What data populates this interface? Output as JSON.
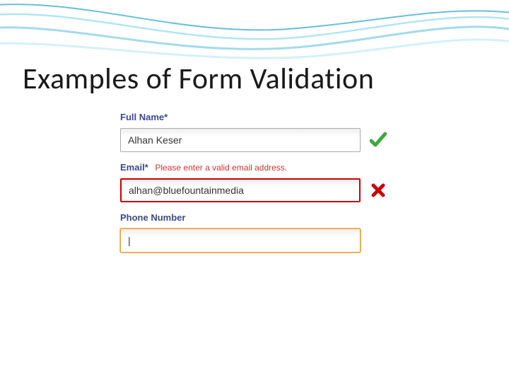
{
  "slide": {
    "title": "Examples of Form Validation"
  },
  "form": {
    "fullname": {
      "label": "Full Name*",
      "value": "Alhan Keser"
    },
    "email": {
      "label": "Email*",
      "error": "Please enter a valid email address.",
      "value": "alhan@bluefountainmedia"
    },
    "phone": {
      "label": "Phone Number",
      "value": "|"
    }
  }
}
